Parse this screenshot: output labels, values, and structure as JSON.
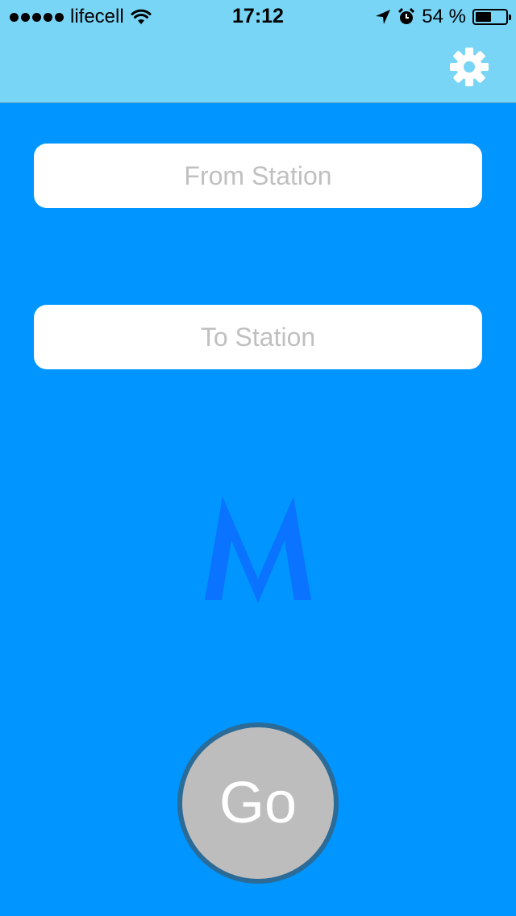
{
  "status_bar": {
    "carrier": "lifecell",
    "time": "17:12",
    "battery": "54 %",
    "battery_level": 0.54
  },
  "header": {
    "settings_icon": "gear-icon"
  },
  "form": {
    "from_placeholder": "From Station",
    "to_placeholder": "To Station"
  },
  "logo": {
    "letter": "M",
    "color": "#0A73FF"
  },
  "go_button": {
    "label": "Go"
  },
  "colors": {
    "background": "#0095FF",
    "header": "#78D5F6",
    "go_button": "#BDBDBD",
    "go_border": "#2B6B97"
  }
}
